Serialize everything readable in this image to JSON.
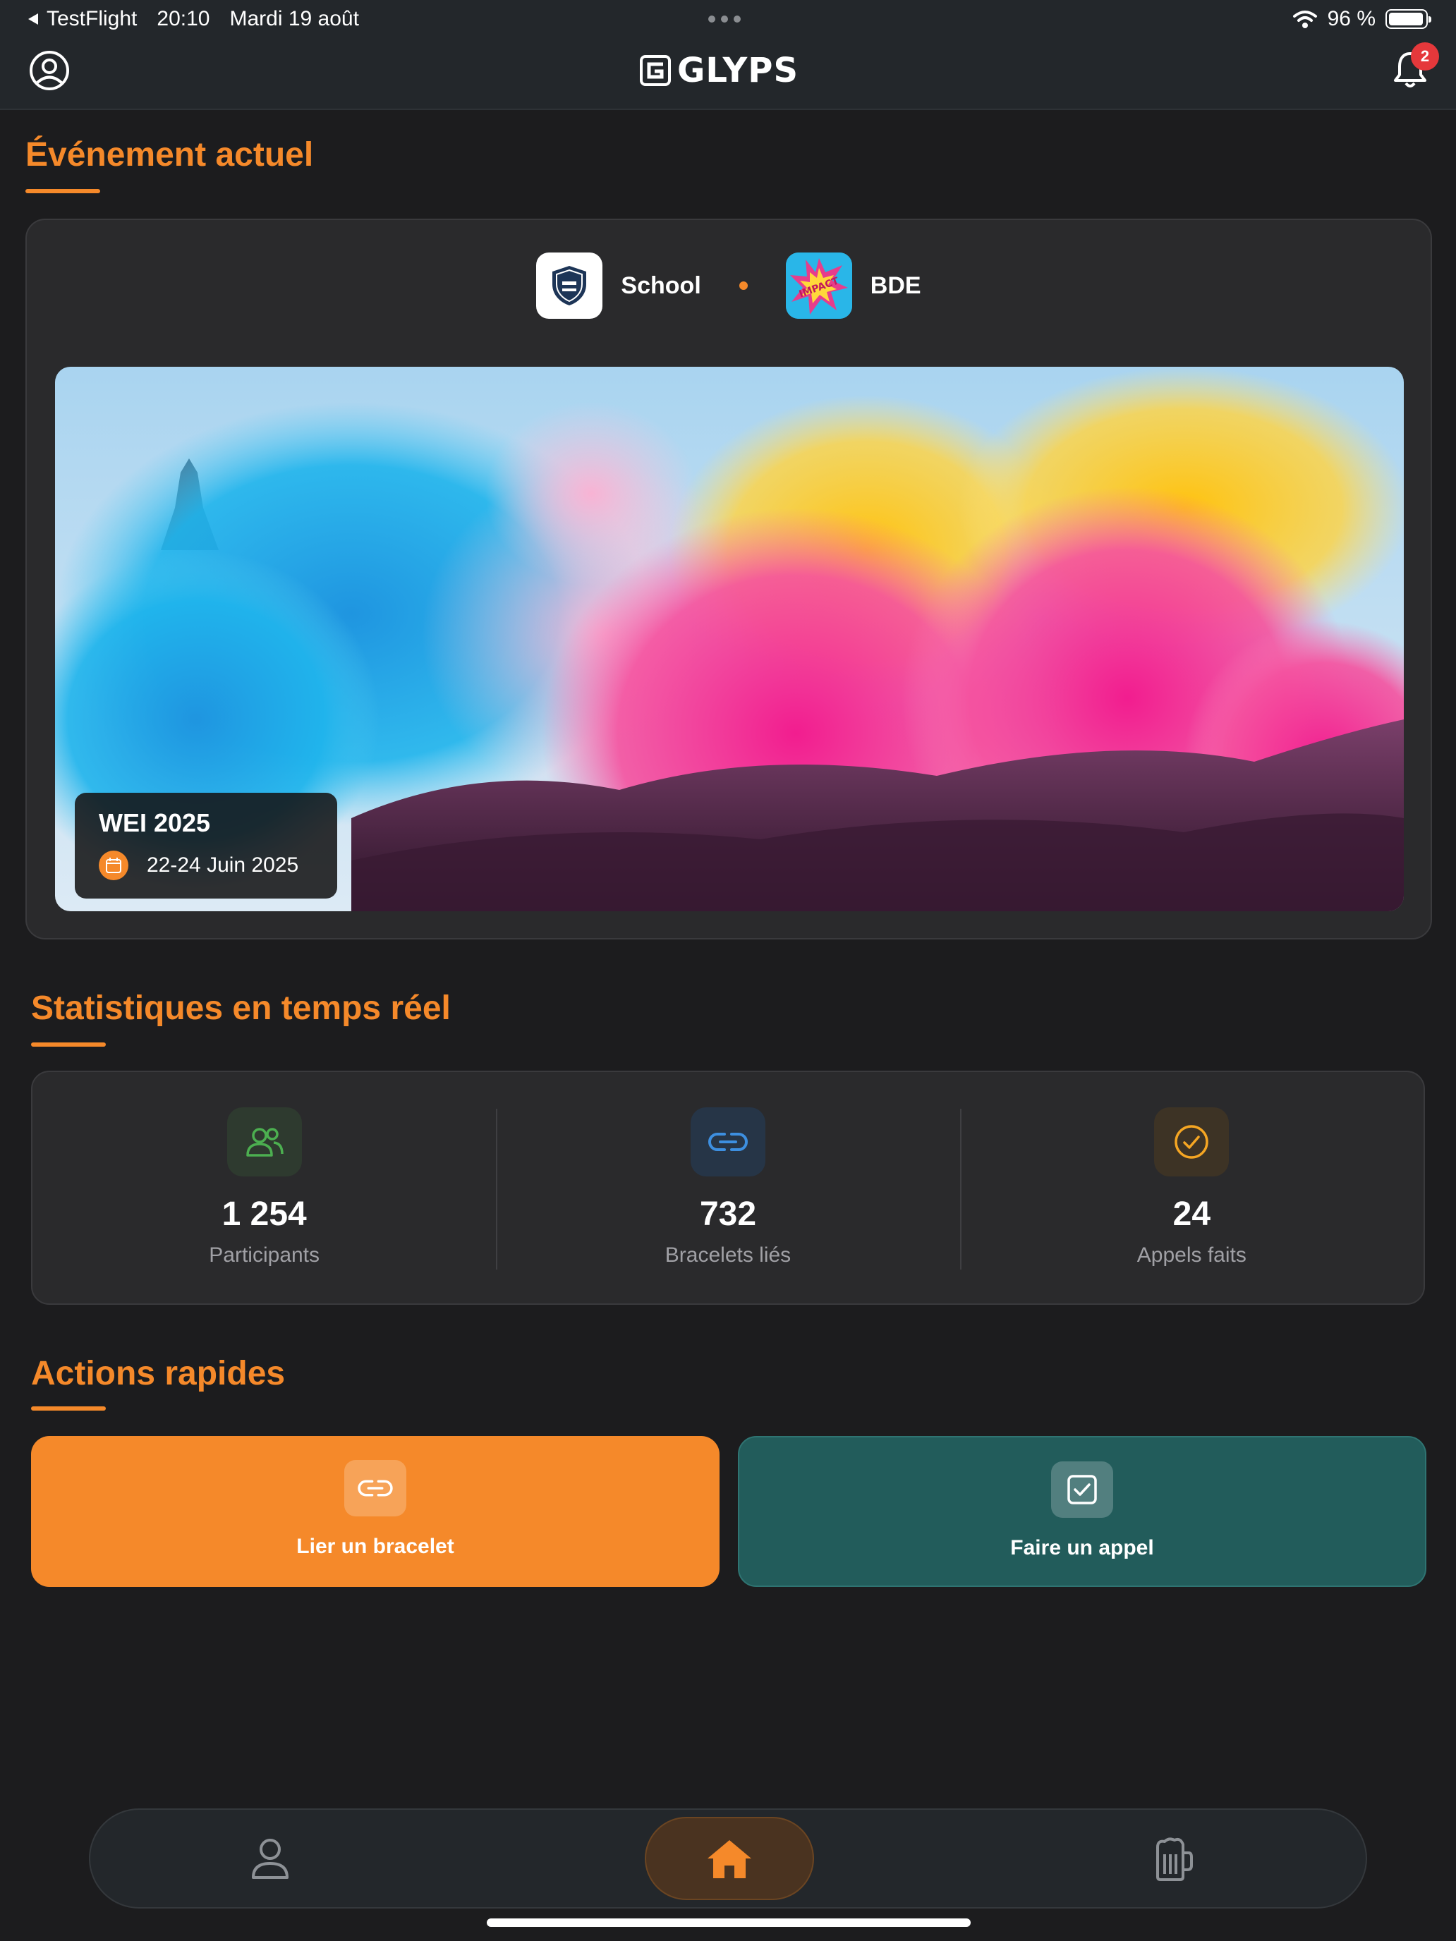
{
  "status_bar": {
    "back_app": "TestFlight",
    "time": "20:10",
    "date": "Mardi 19 août",
    "battery": "96 %",
    "battery_level": 0.96
  },
  "header": {
    "logo_text": "GLYPS",
    "notification_count": "2"
  },
  "current_event": {
    "section_title": "Événement actuel",
    "organizers": [
      {
        "name": "School",
        "logo": "university-shield-logo"
      },
      {
        "name": "BDE",
        "logo": "impact-comic-logo"
      }
    ],
    "event_name": "WEI 2025",
    "event_dates": "22-24 Juin 2025"
  },
  "stats": {
    "section_title": "Statistiques en temps réel",
    "items": [
      {
        "value": "1 254",
        "label": "Participants",
        "icon": "users-icon",
        "color": "#4caf50"
      },
      {
        "value": "732",
        "label": "Bracelets liés",
        "icon": "link-icon",
        "color": "#3d8fe0"
      },
      {
        "value": "24",
        "label": "Appels faits",
        "icon": "check-circle-icon",
        "color": "#f5a623"
      }
    ]
  },
  "actions": {
    "section_title": "Actions rapides",
    "link_bracelet": "Lier un bracelet",
    "roll_call": "Faire un appel"
  },
  "tabbar": {
    "items": [
      "profile-icon",
      "home-icon",
      "beer-mug-icon"
    ],
    "active": "home-icon"
  },
  "colors": {
    "accent": "#f5892a",
    "teal": "#225c5b",
    "background": "#1c1c1e",
    "card": "#2a2a2c"
  }
}
